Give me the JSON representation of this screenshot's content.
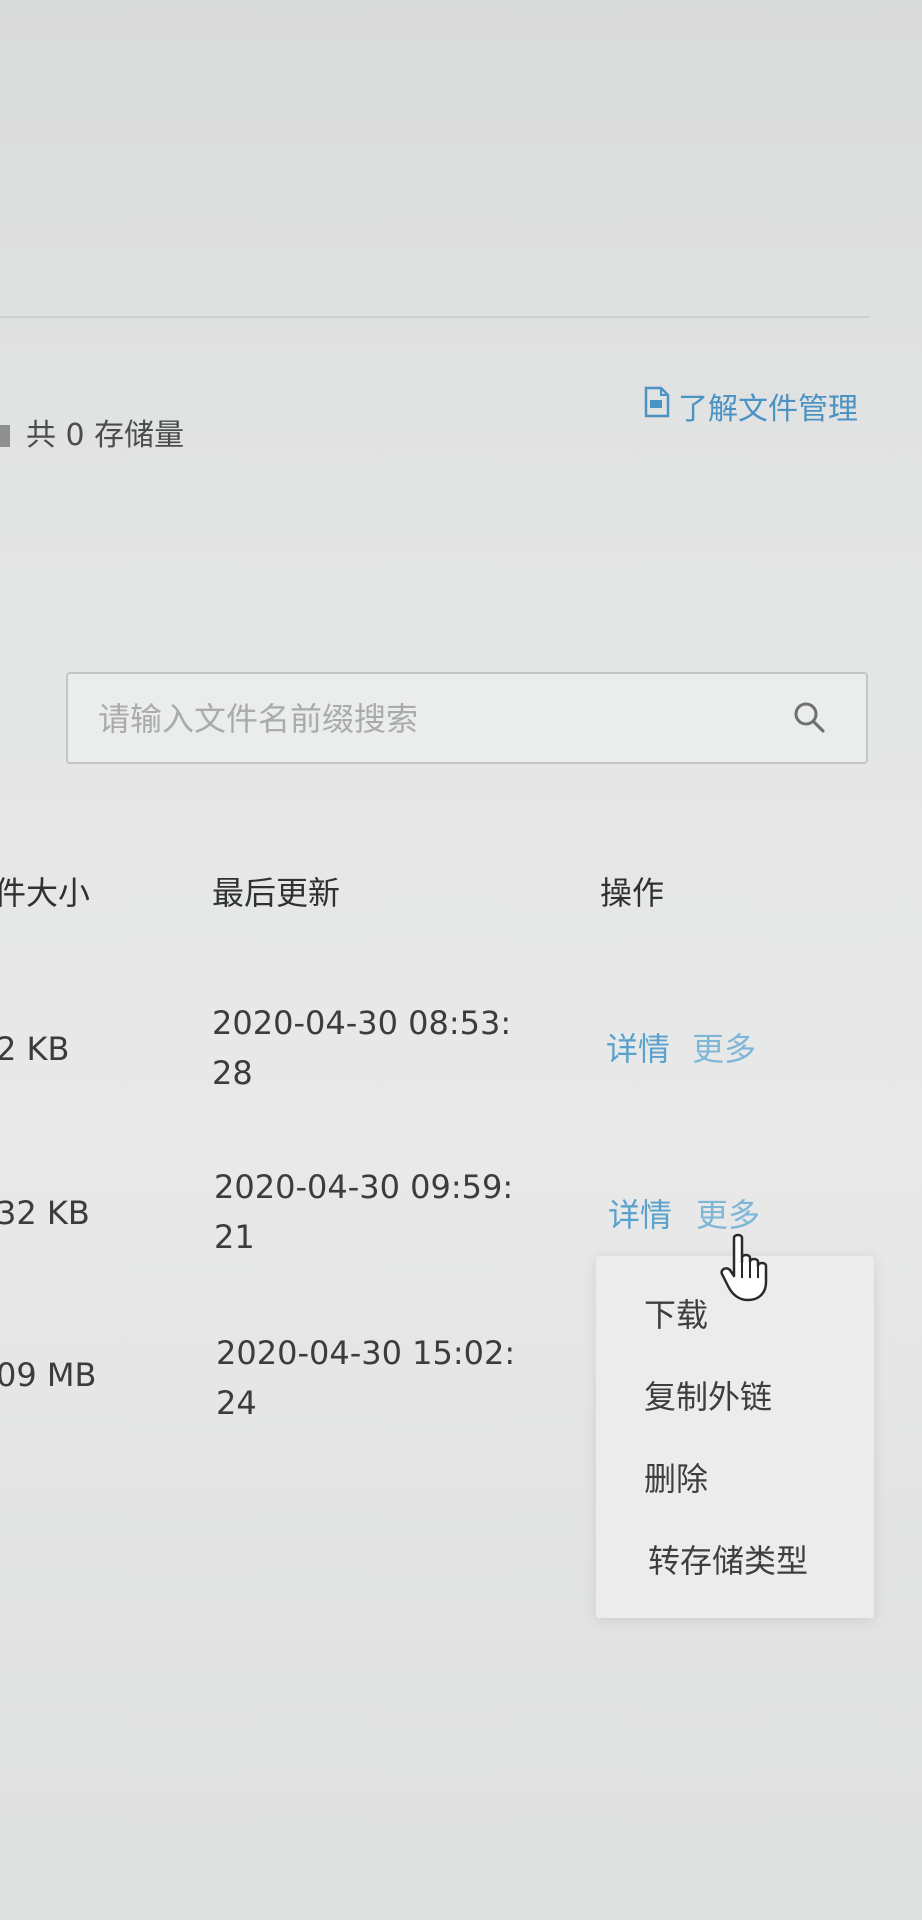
{
  "header": {
    "storage_summary": "共 0 存储量",
    "help_link": "了解文件管理"
  },
  "search": {
    "placeholder": "请输入文件名前缀搜索",
    "icon": "search-icon"
  },
  "table": {
    "columns": [
      "件大小",
      "最后更新",
      "操作"
    ],
    "rows": [
      {
        "size": "2 KB",
        "updated": "2020-04-30 08:53:28",
        "actions": [
          "详情",
          "更多"
        ]
      },
      {
        "size": "32 KB",
        "updated": "2020-04-30 09:59:21",
        "actions": [
          "详情",
          "更多"
        ]
      },
      {
        "size": "09 MB",
        "updated": "2020-04-30 15:02:24",
        "actions": []
      }
    ]
  },
  "more_menu": {
    "items": [
      "下载",
      "复制外链",
      "删除",
      "转存储类型"
    ]
  },
  "colors": {
    "link": "#5aa2cc",
    "help_link": "#4a93c3"
  }
}
